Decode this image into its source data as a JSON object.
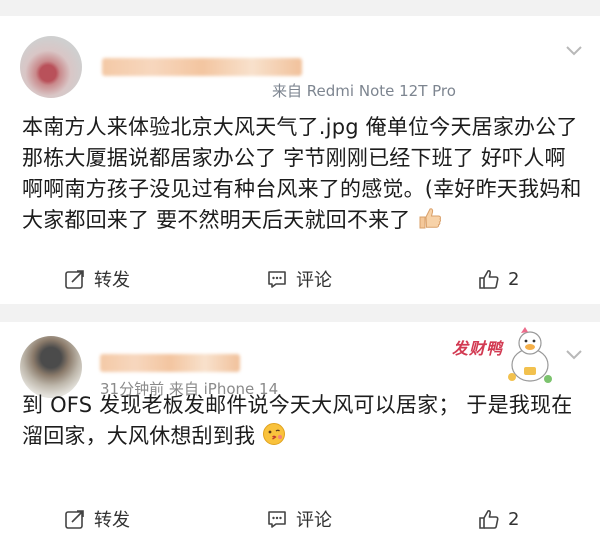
{
  "posts": [
    {
      "device": "Redmi Note 12T Pro",
      "device_prefix": "来自",
      "text": "本南方人来体验北京大风天气了.jpg 俺单位今天居家办公了 那栋大厦据说都居家办公了 字节刚刚已经下班了 好吓人啊啊啊南方孩子没见过有种台风来了的感觉。(幸好昨天我妈和大家都回来了 要不然明天后天就回不来了",
      "end_emoji": "thumbs-up",
      "actions": {
        "repost": "转发",
        "comment": "评论",
        "like": "2"
      }
    },
    {
      "meta": "31分钟前 来自 iPhone 14",
      "sticker_text": "发财鸭",
      "text": "到 OFS 发现老板发邮件说今天大风可以居家； 于是我现在溜回家，大风休想刮到我",
      "end_emoji": "kiss-face",
      "actions": {
        "repost": "转发",
        "comment": "评论",
        "like": "2"
      }
    }
  ],
  "colors": {
    "background": "#f2f2f2",
    "card": "#ffffff",
    "text": "#1c1c1c",
    "meta": "#8a8a8a"
  },
  "icons": [
    "chevron-down-icon",
    "repost-icon",
    "comment-icon",
    "like-icon",
    "thumbs-up-emoji",
    "kiss-face-emoji"
  ]
}
